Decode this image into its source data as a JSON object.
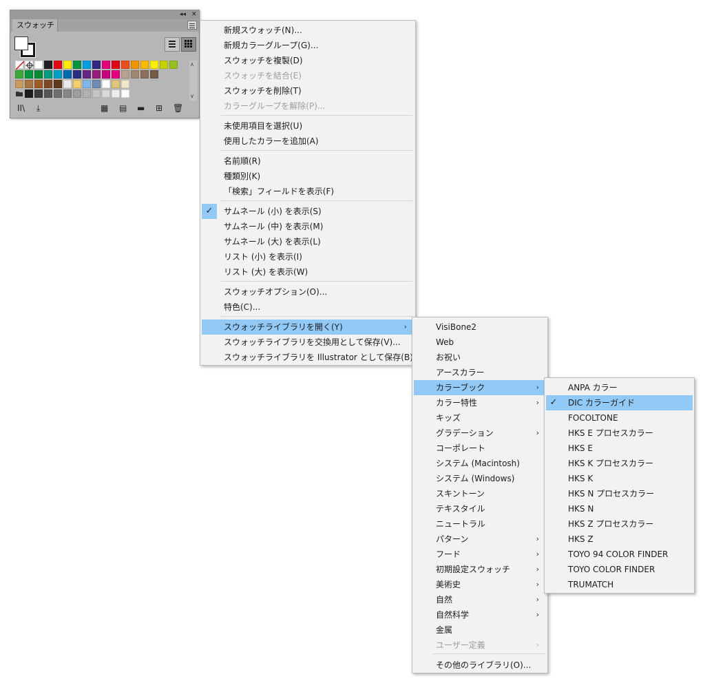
{
  "panel": {
    "tab_label": "スウォッチ",
    "collapse_icon": "double-chevron-left-icon",
    "close_icon": "close-icon",
    "swatch_rows": [
      [
        "#ffffff",
        "#ffffff",
        "#ffffff",
        "#231f20",
        "#e30613",
        "#ffed00",
        "#00963f",
        "#009fe3",
        "#312783",
        "#e5007d",
        "#e30613",
        "#e94e1b",
        "#f39200",
        "#fbba00",
        "#ffed00",
        "#c5d300",
        "#95c11f"
      ],
      [
        "#3aaa35",
        "#00983a",
        "#008d36",
        "#009d81",
        "#00a0c6",
        "#0069b4",
        "#2c2e83",
        "#662483",
        "#951b81",
        "#c8007f",
        "#e6007e",
        "#b9a28d",
        "#a2866f",
        "#8d6e5a",
        "#745a48"
      ],
      [
        "#c99a5b",
        "#a8743f",
        "#a05c25",
        "#7c4b26",
        "#5e3a1c",
        "#ececec",
        "#f5d06a",
        "#7fb7e8",
        "#6f8ab3",
        "#ffffff",
        "#e2c67a",
        "#f0e6c8"
      ],
      [
        "#6f6f6f",
        "#1d1d1b",
        "#3c3c3b",
        "#575756",
        "#706f6f",
        "#878787",
        "#9d9d9c",
        "#b2b2b2",
        "#c6c6c6",
        "#dadada",
        "#ededed",
        "#ffffff"
      ]
    ]
  },
  "menu_main": {
    "items": [
      {
        "label": "新規スウォッチ(N)...",
        "disabled": false
      },
      {
        "label": "新規カラーグループ(G)...",
        "disabled": false
      },
      {
        "label": "スウォッチを複製(D)",
        "disabled": false
      },
      {
        "label": "スウォッチを結合(E)",
        "disabled": true
      },
      {
        "label": "スウォッチを削除(T)",
        "disabled": false
      },
      {
        "label": "カラーグループを解除(P)...",
        "disabled": true
      },
      {
        "label": "未使用項目を選択(U)",
        "disabled": false
      },
      {
        "label": "使用したカラーを追加(A)",
        "disabled": false
      },
      {
        "label": "名前順(R)",
        "disabled": false
      },
      {
        "label": "種類別(K)",
        "disabled": false
      },
      {
        "label": "「検索」フィールドを表示(F)",
        "disabled": false
      },
      {
        "label": "サムネール (小) を表示(S)",
        "disabled": false
      },
      {
        "label": "サムネール (中) を表示(M)",
        "disabled": false
      },
      {
        "label": "サムネール (大) を表示(L)",
        "disabled": false
      },
      {
        "label": "リスト (小) を表示(I)",
        "disabled": false
      },
      {
        "label": "リスト (大) を表示(W)",
        "disabled": false
      },
      {
        "label": "スウォッチオプション(O)...",
        "disabled": false
      },
      {
        "label": "特色(C)...",
        "disabled": false
      },
      {
        "label": "スウォッチライブラリを開く(Y)",
        "disabled": false
      },
      {
        "label": "スウォッチライブラリを交換用として保存(V)...",
        "disabled": false
      },
      {
        "label": "スウォッチライブラリを Illustrator として保存(B)...",
        "disabled": false
      }
    ],
    "checked_label_index": 11,
    "highlight_index": 18,
    "submenu_arrow": "›"
  },
  "menu_libraries": {
    "items": [
      {
        "label": "VisiBone2",
        "submenu": false,
        "disabled": false
      },
      {
        "label": "Web",
        "submenu": false,
        "disabled": false
      },
      {
        "label": "お祝い",
        "submenu": false,
        "disabled": false
      },
      {
        "label": "アースカラー",
        "submenu": false,
        "disabled": false
      },
      {
        "label": "カラーブック",
        "submenu": true,
        "disabled": false
      },
      {
        "label": "カラー特性",
        "submenu": true,
        "disabled": false
      },
      {
        "label": "キッズ",
        "submenu": false,
        "disabled": false
      },
      {
        "label": "グラデーション",
        "submenu": true,
        "disabled": false
      },
      {
        "label": "コーポレート",
        "submenu": false,
        "disabled": false
      },
      {
        "label": "システム (Macintosh)",
        "submenu": false,
        "disabled": false
      },
      {
        "label": "システム (Windows)",
        "submenu": false,
        "disabled": false
      },
      {
        "label": "スキントーン",
        "submenu": false,
        "disabled": false
      },
      {
        "label": "テキスタイル",
        "submenu": false,
        "disabled": false
      },
      {
        "label": "ニュートラル",
        "submenu": false,
        "disabled": false
      },
      {
        "label": "パターン",
        "submenu": true,
        "disabled": false
      },
      {
        "label": "フード",
        "submenu": true,
        "disabled": false
      },
      {
        "label": "初期設定スウォッチ",
        "submenu": true,
        "disabled": false
      },
      {
        "label": "美術史",
        "submenu": true,
        "disabled": false
      },
      {
        "label": "自然",
        "submenu": true,
        "disabled": false
      },
      {
        "label": "自然科学",
        "submenu": true,
        "disabled": false
      },
      {
        "label": "金属",
        "submenu": false,
        "disabled": false
      },
      {
        "label": "ユーザー定義",
        "submenu": true,
        "disabled": true
      },
      {
        "label": "その他のライブラリ(O)...",
        "submenu": false,
        "disabled": false
      }
    ],
    "highlight_index": 4
  },
  "menu_colorbooks": {
    "items": [
      "ANPA カラー",
      "DIC カラーガイド",
      "FOCOLTONE",
      "HKS E プロセスカラー",
      "HKS E",
      "HKS K プロセスカラー",
      "HKS K",
      "HKS N プロセスカラー",
      "HKS N",
      "HKS Z プロセスカラー",
      "HKS Z",
      "TOYO 94 COLOR FINDER",
      "TOYO COLOR FINDER",
      "TRUMATCH"
    ],
    "checked_index": 1
  },
  "colors": {
    "highlight": "#91c9f7",
    "menu_bg": "#f2f2f2",
    "panel_bg": "#b6b6b6"
  },
  "check_glyph": "✓"
}
